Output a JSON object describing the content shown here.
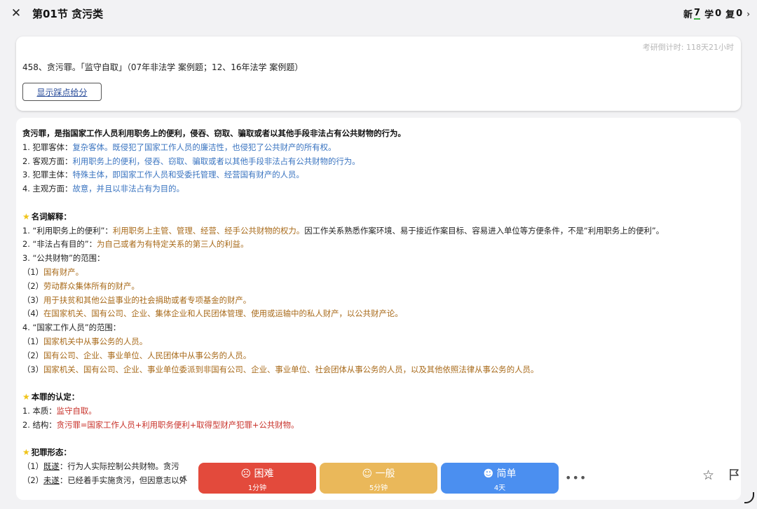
{
  "header": {
    "close_icon": "close-icon",
    "title": "第01节 贪污类",
    "new_label": "新",
    "new_count": "7",
    "learn_label": "学",
    "learn_count": "0",
    "review_label": "复",
    "review_count": "0",
    "chevron": "›"
  },
  "question": {
    "countdown": "考研倒计时: 118天21小时",
    "text": "458、贪污罪。「监守自取」（07年非法学 案例题；12、16年法学 案例题）",
    "show_points_label": "显示踩点给分"
  },
  "answer": {
    "definition": "贪污罪，是指国家工作人员利用职务上的便利，侵吞、窃取、骗取或者以其他手段非法占有公共财物的行为。",
    "elements": [
      {
        "label": "1. 犯罪客体：",
        "value": "复杂客体。既侵犯了国家工作人员的廉洁性，也侵犯了公共财产的所有权。"
      },
      {
        "label": "2. 客观方面：",
        "value": "利用职务上的便利，侵吞、窃取、骗取或者以其他手段非法占有公共财物的行为。"
      },
      {
        "label": "3. 犯罪主体：",
        "value": "特殊主体，即国家工作人员和受委托管理、经营国有财产的人员。"
      },
      {
        "label": "4. 主观方面：",
        "value": "故意，并且以非法占有为目的。"
      }
    ],
    "terms_heading": "名词解释：",
    "term1_label": "1. “利用职务上的便利”：",
    "term1_value": "利用职务上主管、管理、经营、经手公共财物的权力。",
    "term1_note": "因工作关系熟悉作案环境、易于接近作案目标、容易进入单位等方便条件，不是“利用职务上的便利”。",
    "term2_label": "2. “非法占有目的”：",
    "term2_value": "为自己或者为有特定关系的第三人的利益。",
    "term3_label": "3. “公共财物”的范围：",
    "term3_items": [
      {
        "label": "（1）",
        "value": "国有财产。"
      },
      {
        "label": "（2）",
        "value": "劳动群众集体所有的财产。"
      },
      {
        "label": "（3）",
        "value": "用于扶贫和其他公益事业的社会捐助或者专项基金的财产。"
      },
      {
        "label": "（4）",
        "value": "在国家机关、国有公司、企业、集体企业和人民团体管理、使用或运输中的私人财产，以公共财产论。"
      }
    ],
    "term4_label": "4. “国家工作人员”的范围：",
    "term4_items": [
      {
        "label": "（1）",
        "value": "国家机关中从事公务的人员。"
      },
      {
        "label": "（2）",
        "value": "国有公司、企业、事业单位、人民团体中从事公务的人员。"
      },
      {
        "label": "（3）",
        "value": "国家机关、国有公司、企业、事业单位委派到非国有公司、企业、事业单位、社会团体从事公务的人员，以及其他依照法律从事公务的人员。"
      }
    ],
    "identify_heading": "本罪的认定：",
    "essence_label": "1. 本质：",
    "essence_value": "监守自取。",
    "structure_label": "2. 结构：",
    "structure_value": "贪污罪=国家工作人员+利用职务便利+取得型财产犯罪+公共财物。",
    "forms_heading": "犯罪形态：",
    "form1_num": "（1）",
    "form1_label": "既遂",
    "form1_value": "：行为人实际控制公共财物。贪污",
    "form2_num": "（2）",
    "form2_label": "未遂",
    "form2_value": "：已经着手实施贪污，但因意志以外"
  },
  "controls": {
    "hard_label": "困难",
    "hard_time": "1分钟",
    "normal_label": "一般",
    "normal_time": "5分钟",
    "easy_label": "简单",
    "easy_time": "4天",
    "more": "•••",
    "colors": {
      "hard": "#e34a3c",
      "normal": "#eab85a",
      "easy": "#4b8ff0"
    }
  }
}
